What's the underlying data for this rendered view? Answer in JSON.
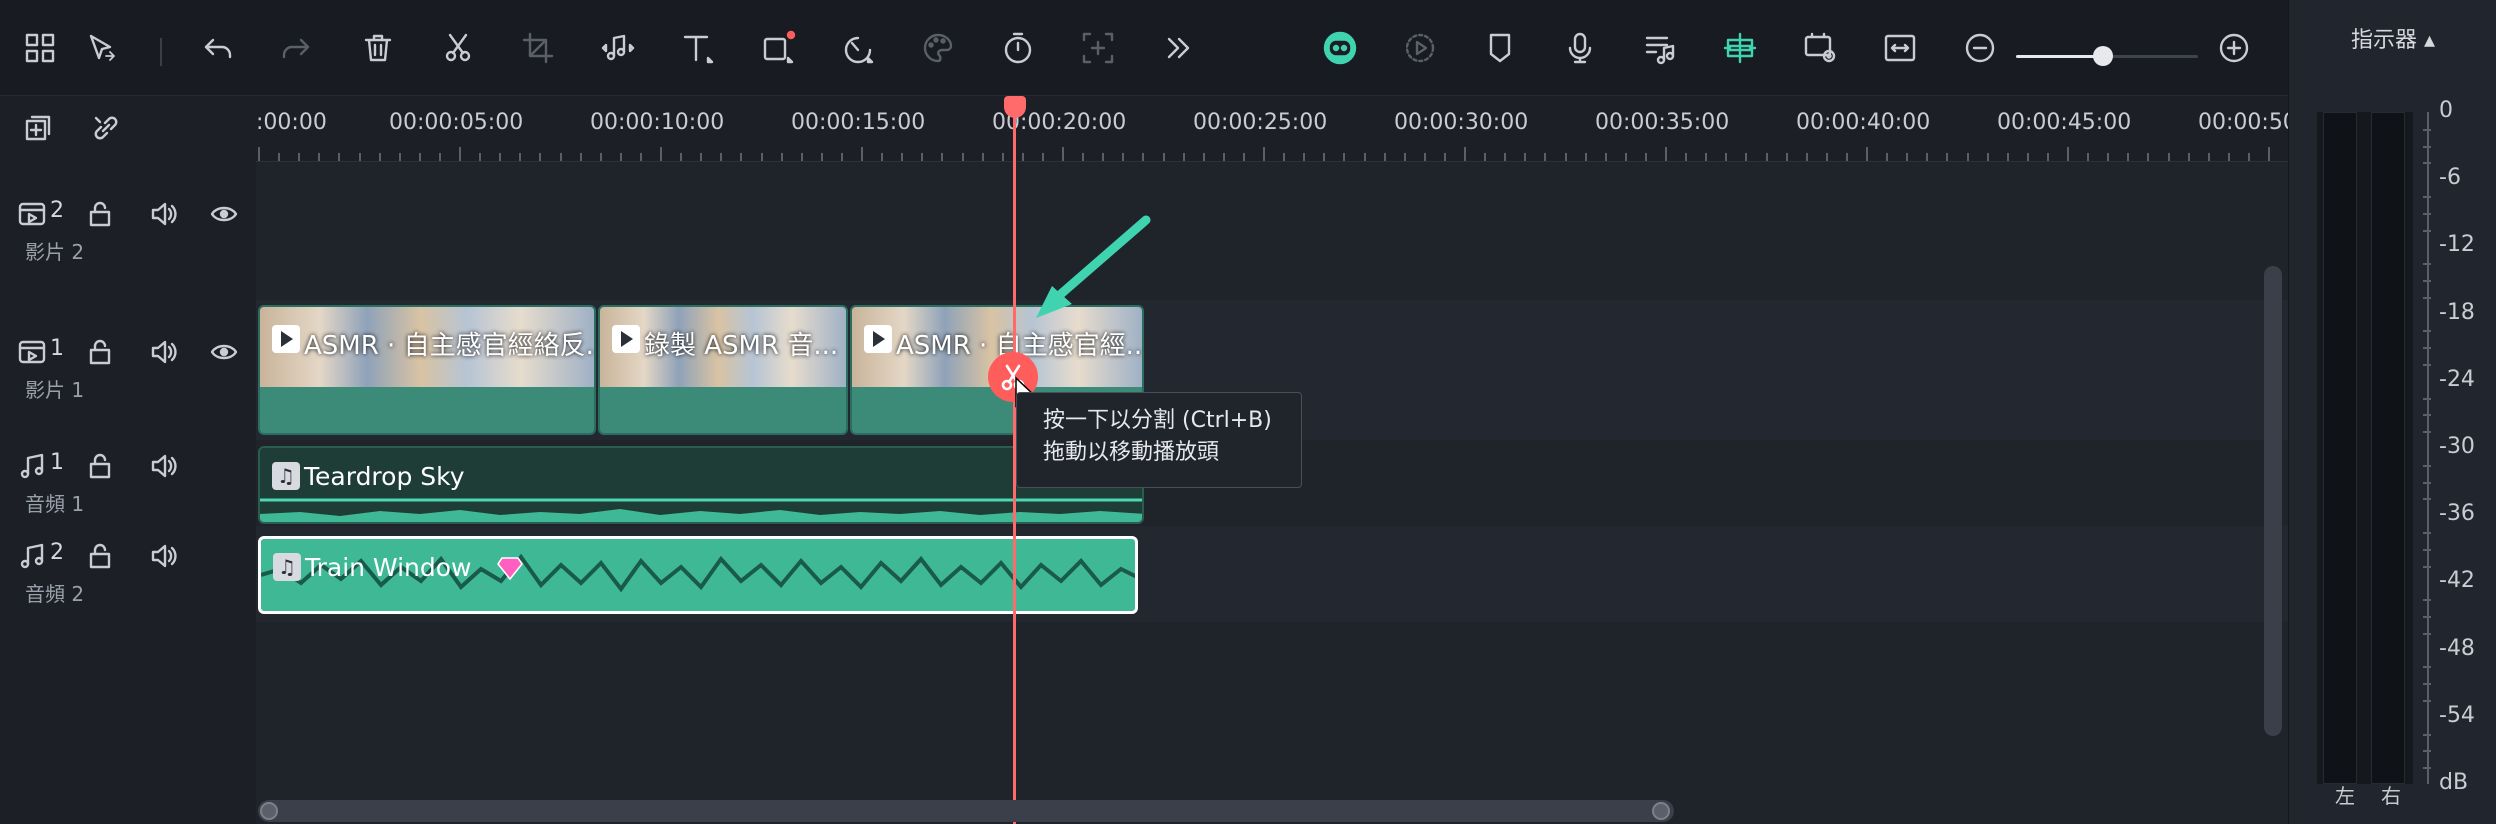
{
  "toolbar": {
    "left_icons": [
      "layout-icon",
      "select-pointer-icon",
      "undo-icon",
      "redo-icon",
      "delete-icon",
      "scissors-icon",
      "crop-icon",
      "audio-split-icon",
      "text-icon",
      "shape-icon",
      "speed-icon",
      "color-palette-icon",
      "timer-icon",
      "add-marker-icon",
      "more-icon"
    ],
    "right_icons": [
      "ai-robot-icon",
      "render-preview-icon",
      "marker-icon",
      "microphone-icon",
      "audio-mix-icon",
      "snap-icon",
      "preview-quality-icon",
      "fit-timeline-icon",
      "zoom-out-icon",
      "zoom-in-icon"
    ],
    "zoom_level": 0.48
  },
  "meter": {
    "title": "指示器 ▴",
    "scale": [
      "0",
      "-6",
      "-12",
      "-18",
      "-24",
      "-30",
      "-36",
      "-42",
      "-48",
      "-54",
      "dB"
    ],
    "left_channel": "左",
    "right_channel": "右"
  },
  "ruler": {
    "labels": [
      ":00:00",
      "00:00:05:00",
      "00:00:10:00",
      "00:00:15:00",
      "00:00:20:00",
      "00:00:25:00",
      "00:00:30:00",
      "00:00:35:00",
      "00:00:40:00",
      "00:00:45:00",
      "00:00:50"
    ]
  },
  "tracks": {
    "video2": {
      "num": "2",
      "name": "影片 2"
    },
    "video1": {
      "num": "1",
      "name": "影片 1"
    },
    "audio1": {
      "num": "1",
      "name": "音頻 1"
    },
    "audio2": {
      "num": "2",
      "name": "音頻 2"
    }
  },
  "clips": {
    "video": [
      {
        "title": "ASMR · 自主感官經絡反..."
      },
      {
        "title": "錄製 ASMR 音..."
      },
      {
        "title": "ASMR · 自主感官經..."
      }
    ],
    "audio1": {
      "title": "Teardrop Sky"
    },
    "audio2": {
      "title": "Train Window"
    }
  },
  "tooltip": {
    "line1": "按一下以分割 (Ctrl+B)",
    "line2": "拖動以移動播放頭"
  },
  "colors": {
    "accent": "#3fd3b0",
    "playhead": "#ff6a6a",
    "clip_video": "#3c8a78",
    "clip_audio_selected": "#3fb896",
    "clip_audio": "#1e3d36"
  }
}
